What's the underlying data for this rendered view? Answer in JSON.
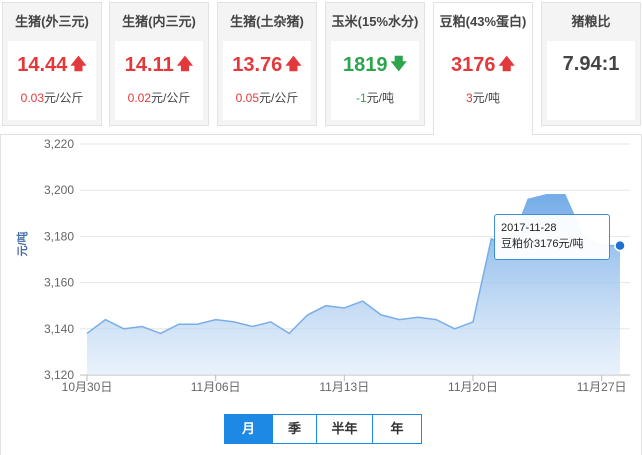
{
  "cards": [
    {
      "title": "生猪(外三元)",
      "price": "14.44",
      "trend": "up",
      "change": "0.03",
      "unit": "元/公斤"
    },
    {
      "title": "生猪(内三元)",
      "price": "14.11",
      "trend": "up",
      "change": "0.02",
      "unit": "元/公斤"
    },
    {
      "title": "生猪(土杂猪)",
      "price": "13.76",
      "trend": "up",
      "change": "0.05",
      "unit": "元/公斤"
    },
    {
      "title": "玉米(15%水分)",
      "price": "1819",
      "trend": "down",
      "change": "-1",
      "unit": "元/吨"
    },
    {
      "title": "豆粕(43%蛋白)",
      "price": "3176",
      "trend": "up",
      "change": "3",
      "unit": "元/吨"
    },
    {
      "title": "猪粮比",
      "price": "7.94:1",
      "trend": "neutral",
      "change": "",
      "unit": ""
    }
  ],
  "arrows": {
    "up": "🡅",
    "down": "🡇"
  },
  "tooltip": {
    "date": "2017-11-28",
    "label": "豆粕价3176元/吨"
  },
  "periods": [
    "月",
    "季",
    "半年",
    "年"
  ],
  "active_period": "月",
  "colors": {
    "up": "#e4393c",
    "down": "#2fa44f",
    "line": "#7aaee6",
    "accent": "#1e88e5"
  },
  "chart_data": {
    "type": "area",
    "ylabel": "元/吨",
    "ylim": [
      3120,
      3220
    ],
    "yticks": [
      3120,
      3140,
      3160,
      3180,
      3200,
      3220
    ],
    "yticklabels": [
      "3,120",
      "3,140",
      "3,160",
      "3,180",
      "3,200",
      "3,220"
    ],
    "xlim": [
      "10月30日",
      "11月28日"
    ],
    "xticks": [
      "10月30日",
      "11月06日",
      "11月13日",
      "11月20日",
      "11月27日"
    ],
    "grid": true,
    "x": [
      "10月30日",
      "10月31日",
      "11月01日",
      "11月02日",
      "11月03日",
      "11月04日",
      "11月05日",
      "11月06日",
      "11月07日",
      "11月08日",
      "11月09日",
      "11月10日",
      "11月11日",
      "11月12日",
      "11月13日",
      "11月14日",
      "11月15日",
      "11月16日",
      "11月17日",
      "11月18日",
      "11月19日",
      "11月20日",
      "11月21日",
      "11月22日",
      "11月23日",
      "11月24日",
      "11月25日",
      "11月26日",
      "11月27日",
      "11月28日"
    ],
    "values": [
      3138,
      3144,
      3140,
      3141,
      3138,
      3142,
      3142,
      3144,
      3143,
      3141,
      3143,
      3138,
      3146,
      3150,
      3149,
      3152,
      3146,
      3144,
      3145,
      3144,
      3140,
      3143,
      3179,
      3175,
      3196,
      3198,
      3198,
      3180,
      3176,
      3176
    ],
    "highlight_index": 29
  }
}
